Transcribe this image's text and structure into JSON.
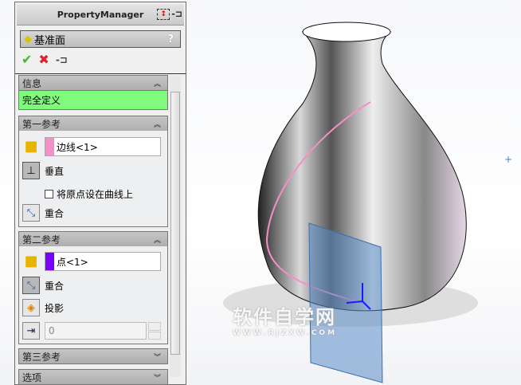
{
  "panel": {
    "title": "PropertyManager",
    "feature_name": "基准面",
    "help": "?",
    "info": {
      "header": "信息",
      "status": "完全定义"
    },
    "ref1": {
      "header": "第一参考",
      "selection": "边线<1>",
      "swatch": "#f48fc8",
      "constraint1": "垂直",
      "checkbox_label": "将原点设在曲线上",
      "checkbox_checked": false,
      "constraint2": "重合"
    },
    "ref2": {
      "header": "第二参考",
      "selection": "点<1>",
      "swatch": "#7a00ff",
      "constraint1": "重合",
      "constraint2": "投影",
      "value": "0"
    },
    "ref3": {
      "header": "第三参考"
    },
    "options": {
      "header": "选项"
    }
  },
  "watermark": {
    "title": "软件自学网",
    "url": "WWW.RJZXW.COM"
  }
}
